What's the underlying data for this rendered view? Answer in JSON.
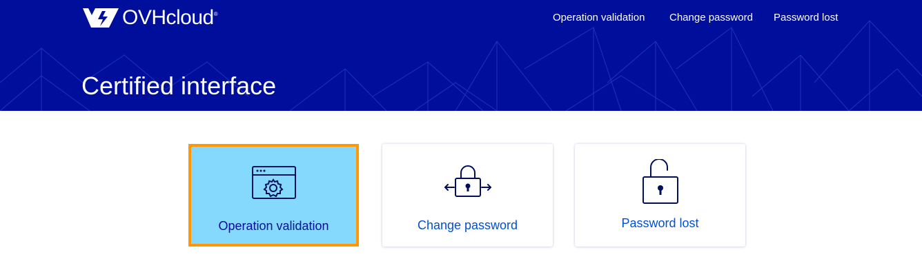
{
  "brand": {
    "name": "OVHcloud",
    "reg_mark": "®"
  },
  "nav": {
    "items": [
      {
        "label": "Operation validation"
      },
      {
        "label": "Change password"
      },
      {
        "label": "Password lost"
      }
    ]
  },
  "page": {
    "title": "Certified interface"
  },
  "cards": [
    {
      "label": "Operation validation",
      "icon": "browser-gear-icon",
      "selected": true
    },
    {
      "label": "Change password",
      "icon": "padlock-arrows-icon",
      "selected": false
    },
    {
      "label": "Password lost",
      "icon": "open-padlock-icon",
      "selected": false
    }
  ],
  "colors": {
    "header_bg": "#000e9c",
    "link_blue": "#0050d7",
    "selected_card_bg": "#85d9fd",
    "selected_border": "#ff9803"
  }
}
